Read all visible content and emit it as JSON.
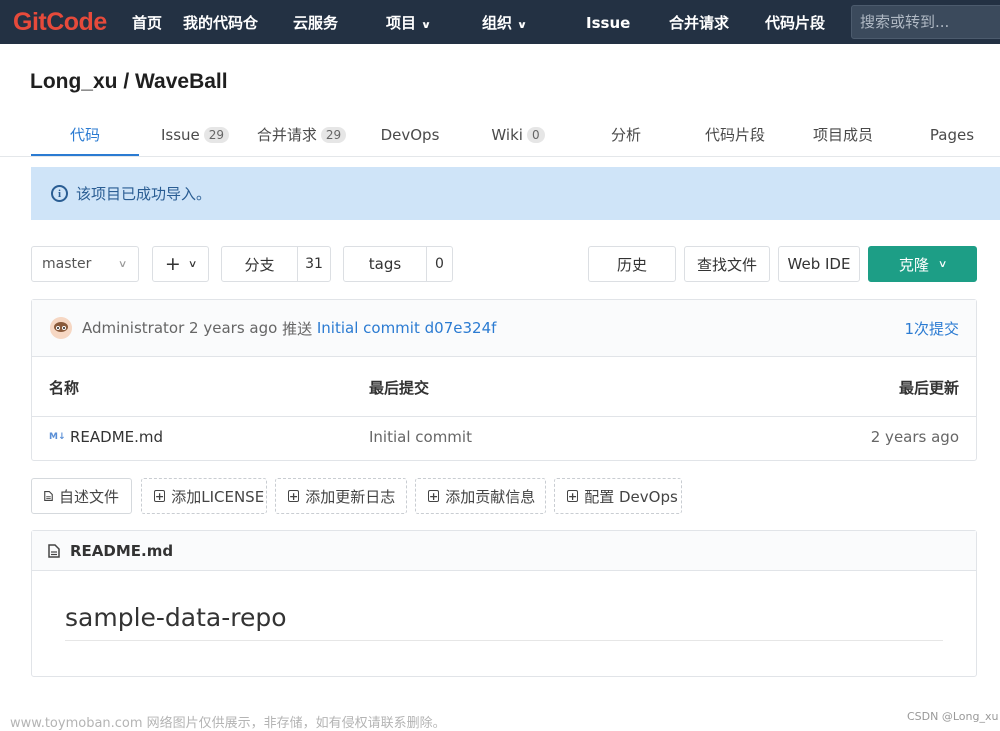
{
  "topbar": {
    "logo": "GitCode",
    "nav": [
      {
        "label": "首页"
      },
      {
        "label": "我的代码仓"
      },
      {
        "label": "云服务"
      },
      {
        "label": "项目",
        "dropdown": true
      },
      {
        "label": "组织",
        "dropdown": true
      },
      {
        "label": "Issue"
      },
      {
        "label": "合并请求"
      },
      {
        "label": "代码片段"
      }
    ],
    "search_placeholder": "搜索或转到..."
  },
  "repo": {
    "title": "Long_xu / WaveBall"
  },
  "tabs": [
    {
      "label": "代码",
      "active": true
    },
    {
      "label": "Issue",
      "badge": "29"
    },
    {
      "label": "合并请求",
      "badge": "29"
    },
    {
      "label": "DevOps"
    },
    {
      "label": "Wiki",
      "badge": "0"
    },
    {
      "label": "分析"
    },
    {
      "label": "代码片段"
    },
    {
      "label": "项目成员"
    },
    {
      "label": "Pages"
    }
  ],
  "alert": {
    "icon": "info-icon",
    "text": "该项目已成功导入。"
  },
  "toolbar": {
    "branch_select": "master",
    "add_label": "+",
    "branches_label": "分支",
    "branches_count": "31",
    "tags_label": "tags",
    "tags_count": "0",
    "history": "历史",
    "find_file": "查找文件",
    "web_ide": "Web IDE",
    "clone": "克隆"
  },
  "last_commit": {
    "author": "Administrator",
    "time": "2 years ago",
    "action": "推送",
    "message": "Initial commit",
    "hash": "d07e324f",
    "commit_count": "1次提交"
  },
  "file_table": {
    "headers": {
      "name": "名称",
      "last_commit": "最后提交",
      "last_update": "最后更新"
    },
    "rows": [
      {
        "name": "README.md",
        "icon": "markdown-icon",
        "commit": "Initial commit",
        "updated": "2 years ago"
      }
    ]
  },
  "quick_actions": [
    {
      "label": "自述文件",
      "icon": "file-icon"
    },
    {
      "label": "添加LICENSE",
      "icon": "plus-box-icon"
    },
    {
      "label": "添加更新日志",
      "icon": "plus-box-icon"
    },
    {
      "label": "添加贡献信息",
      "icon": "plus-box-icon"
    },
    {
      "label": "配置 DevOps",
      "icon": "plus-box-icon"
    }
  ],
  "readme": {
    "filename": "README.md",
    "heading": "sample-data-repo"
  },
  "footer": {
    "watermark": "www.toymoban.com 网络图片仅供展示，非存储，如有侵权请联系删除。",
    "credit": "CSDN @Long_xu"
  },
  "colors": {
    "topbar": "#233143",
    "accent": "#2b7bd2",
    "clone": "#1d9e86",
    "logo": "#e64a3b",
    "alert_bg": "#cfe4f8"
  }
}
